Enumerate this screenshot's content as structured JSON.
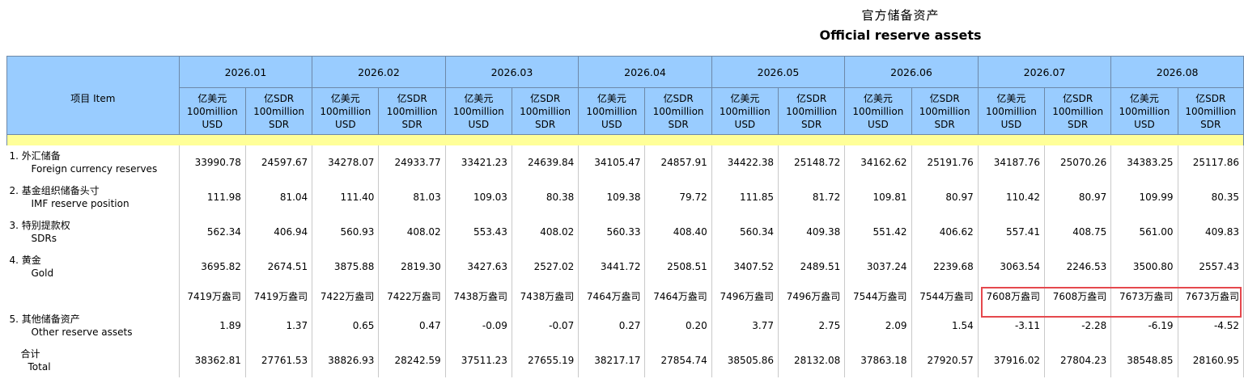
{
  "title": {
    "cn": "官方储备资产",
    "en": "Official reserve assets"
  },
  "header": {
    "item_label": "项目  Item",
    "months": [
      "2026.01",
      "2026.02",
      "2026.03",
      "2026.04",
      "2026.05",
      "2026.06",
      "2026.07",
      "2026.08"
    ],
    "unit_usd": [
      "亿美元",
      "100million",
      "USD"
    ],
    "unit_sdr": [
      "亿SDR",
      "100million",
      "SDR"
    ]
  },
  "rows": [
    {
      "cn": "1.  外汇储备",
      "en": "Foreign currency reserves",
      "values": [
        "33990.78",
        "24597.67",
        "34278.07",
        "24933.77",
        "33421.23",
        "24639.84",
        "34105.47",
        "24857.91",
        "34422.38",
        "25148.72",
        "34162.62",
        "25191.76",
        "34187.76",
        "25070.26",
        "34383.25",
        "25117.86"
      ]
    },
    {
      "cn": "2.  基金组织储备头寸",
      "en": "IMF reserve position",
      "values": [
        "111.98",
        "81.04",
        "111.40",
        "81.03",
        "109.03",
        "80.38",
        "109.38",
        "79.72",
        "111.85",
        "81.72",
        "109.81",
        "80.97",
        "110.42",
        "80.97",
        "109.99",
        "80.35"
      ]
    },
    {
      "cn": "3.  特别提款权",
      "en": "SDRs",
      "values": [
        "562.34",
        "406.94",
        "560.93",
        "408.02",
        "553.43",
        "408.02",
        "560.33",
        "408.40",
        "560.34",
        "409.38",
        "551.42",
        "406.62",
        "557.41",
        "408.75",
        "561.00",
        "409.83"
      ]
    },
    {
      "cn": "4.  黄金",
      "en": "Gold",
      "values": [
        "3695.82",
        "2674.51",
        "3875.88",
        "2819.30",
        "3427.63",
        "2527.02",
        "3441.72",
        "2508.51",
        "3407.52",
        "2489.51",
        "3037.24",
        "2239.68",
        "3063.54",
        "2246.53",
        "3500.80",
        "2557.43"
      ]
    },
    {
      "cn": "",
      "en": "",
      "values": [
        "7419万盎司",
        "7419万盎司",
        "7422万盎司",
        "7422万盎司",
        "7438万盎司",
        "7438万盎司",
        "7464万盎司",
        "7464万盎司",
        "7496万盎司",
        "7496万盎司",
        "7544万盎司",
        "7544万盎司",
        "7608万盎司",
        "7608万盎司",
        "7673万盎司",
        "7673万盎司"
      ]
    },
    {
      "cn": "5.  其他储备资产",
      "en": "Other reserve assets",
      "values": [
        "1.89",
        "1.37",
        "0.65",
        "0.47",
        "-0.09",
        "-0.07",
        "0.27",
        "0.20",
        "3.77",
        "2.75",
        "2.09",
        "1.54",
        "-3.11",
        "-2.28",
        "-6.19",
        "-4.52"
      ]
    },
    {
      "cn": "合计",
      "en": "Total",
      "values": [
        "38362.81",
        "27761.53",
        "38826.93",
        "28242.59",
        "37511.23",
        "27655.19",
        "38217.17",
        "27854.74",
        "38505.86",
        "28132.08",
        "37863.18",
        "27920.57",
        "37916.02",
        "27804.23",
        "38548.85",
        "28160.95"
      ]
    }
  ],
  "highlight": {
    "color": "#e5484d"
  },
  "colors": {
    "header_bg": "#99ccff",
    "yellow_band": "#ffff99"
  }
}
